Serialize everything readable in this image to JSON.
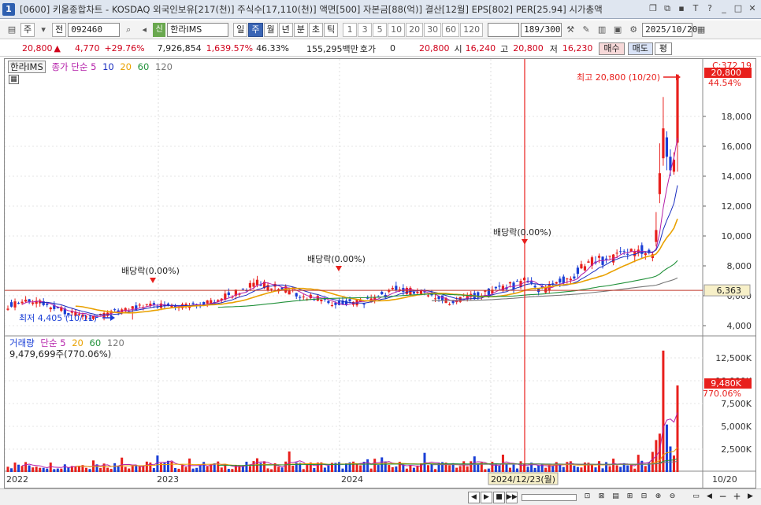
{
  "window": {
    "number": "1",
    "title": "[0600] 키움종합차트 - KOSDAQ 외국인보유[217(천)] 주식수[17,110(천)] 액면[500] 자본금[88(억)] 결산[12월] EPS[802] PER[25.94] 시가총액"
  },
  "toolbar": {
    "period": "주",
    "prev_label": "전",
    "code": "092460",
    "badge": "신",
    "stock_name": "한라IMS",
    "periods": [
      "일",
      "주",
      "월",
      "년",
      "분",
      "초",
      "틱"
    ],
    "active_period": "주",
    "numbers": [
      "1",
      "3",
      "5",
      "10",
      "20",
      "30",
      "60",
      "120"
    ],
    "count": "189/300",
    "date": "2025/10/20"
  },
  "quote": {
    "price": "20,800",
    "arrow": "▲",
    "change": "4,770",
    "change_pct": "+29.76%",
    "volume": "7,926,854",
    "volume_pct": "1,639.57%",
    "turnover_pct": "46.33%",
    "amount": "155,295백만",
    "hoga_label": "호가",
    "hoga_value": "0",
    "hoga_price": "20,800",
    "open_label": "시",
    "open": "16,240",
    "high_label": "고",
    "high": "20,800",
    "low_label": "저",
    "low": "16,230",
    "buy": "매수",
    "sell": "매도",
    "eval": "평"
  },
  "price_panel": {
    "legend_name": "한라IMS",
    "legend_ma": "종가 단순",
    "ma_periods": [
      "5",
      "10",
      "20",
      "60",
      "120"
    ],
    "y_ticks": [
      "18,000",
      "16,000",
      "14,000",
      "12,000",
      "10,000",
      "8,000",
      "6,000",
      "4,000"
    ],
    "top_label": "C:372.19",
    "last_tag": "20,800",
    "last_pct": "44.54%",
    "line_tag": "6,363",
    "annotations": {
      "max": "최고 20,800 (10/20)",
      "min": "최저 4,405 (10/11)",
      "div1": "배당락(0.00%)",
      "div2": "배당락(0.00%)",
      "div3": "배당락(0.00%)"
    }
  },
  "volume_panel": {
    "legend_name": "거래량",
    "legend_ma": "단순",
    "ma_periods": [
      "5",
      "20",
      "60",
      "120"
    ],
    "value_line": "9,479,699주(770.06%)",
    "y_ticks": [
      "12,500K",
      "10,000K",
      "7,500K",
      "5,000K",
      "2,500K"
    ],
    "last_tag": "9,480K",
    "last_pct": "770.06%"
  },
  "x_axis": {
    "labels": [
      "2022",
      "2023",
      "2024"
    ],
    "cursor_label": "2024/12/23(월)",
    "right_label": "10/20"
  },
  "colors": {
    "up": "#e8201d",
    "down": "#1a3fd6",
    "ma5": "#b41fa9",
    "ma10": "#1a2dbf",
    "ma20": "#e9a100",
    "ma60": "#21913a",
    "ma120": "#777777"
  }
}
